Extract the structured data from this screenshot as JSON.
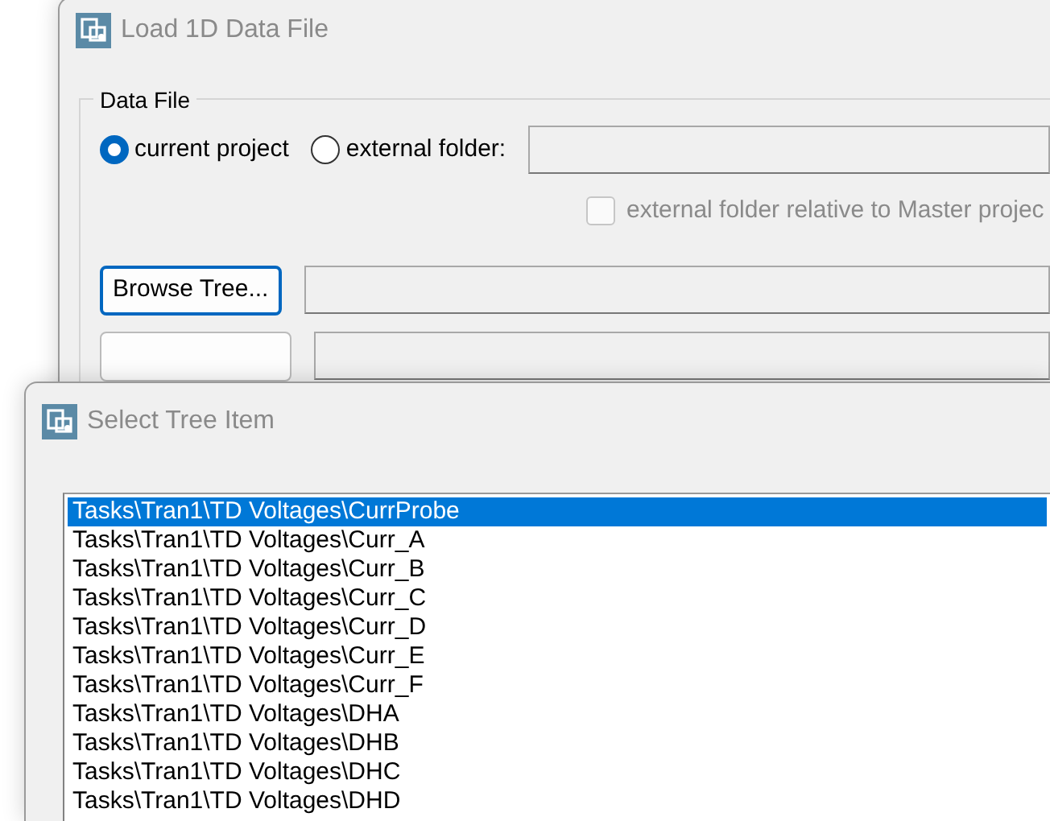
{
  "load_window": {
    "title": "Load 1D Data File",
    "group_title": "Data File",
    "source_options": [
      {
        "label": "current project",
        "selected": true
      },
      {
        "label": "external folder:",
        "selected": false
      }
    ],
    "relative_checkbox": {
      "label": "external folder relative to Master projec",
      "checked": false,
      "disabled": true
    },
    "browse_tree_button": "Browse Tree..."
  },
  "select_window": {
    "title": "Select Tree Item",
    "items": [
      {
        "label": "Tasks\\Tran1\\TD Voltages\\CurrProbe",
        "selected": true
      },
      {
        "label": "Tasks\\Tran1\\TD Voltages\\Curr_A",
        "selected": false
      },
      {
        "label": "Tasks\\Tran1\\TD Voltages\\Curr_B",
        "selected": false
      },
      {
        "label": "Tasks\\Tran1\\TD Voltages\\Curr_C",
        "selected": false
      },
      {
        "label": "Tasks\\Tran1\\TD Voltages\\Curr_D",
        "selected": false
      },
      {
        "label": "Tasks\\Tran1\\TD Voltages\\Curr_E",
        "selected": false
      },
      {
        "label": "Tasks\\Tran1\\TD Voltages\\Curr_F",
        "selected": false
      },
      {
        "label": "Tasks\\Tran1\\TD Voltages\\DHA",
        "selected": false
      },
      {
        "label": "Tasks\\Tran1\\TD Voltages\\DHB",
        "selected": false
      },
      {
        "label": "Tasks\\Tran1\\TD Voltages\\DHC",
        "selected": false
      },
      {
        "label": "Tasks\\Tran1\\TD Voltages\\DHD",
        "selected": false
      }
    ]
  }
}
